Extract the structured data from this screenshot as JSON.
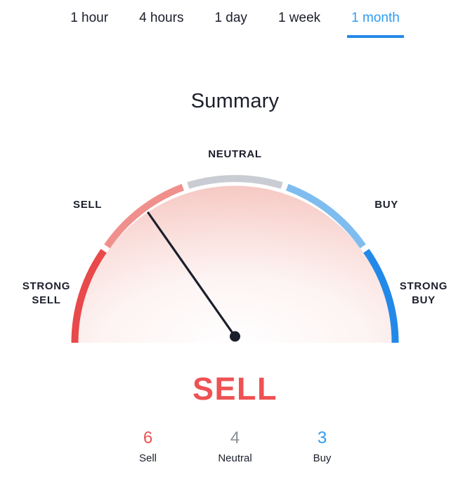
{
  "tabs": {
    "items": [
      {
        "label": "1 hour",
        "active": false
      },
      {
        "label": "4 hours",
        "active": false
      },
      {
        "label": "1 day",
        "active": false
      },
      {
        "label": "1 week",
        "active": false
      },
      {
        "label": "1 month",
        "active": true
      }
    ],
    "active_color": "#2f9cf4",
    "inactive_color": "#1b1f2b",
    "underline_color": "#2389e8"
  },
  "title": "Summary",
  "gauge": {
    "zone_labels": {
      "strong_sell_line1": "STRONG",
      "strong_sell_line2": "SELL",
      "sell": "SELL",
      "neutral": "NEUTRAL",
      "buy": "BUY",
      "strong_buy_line1": "STRONG",
      "strong_buy_line2": "BUY"
    },
    "verdict": "SELL",
    "verdict_color": "#ee5253",
    "needle_color": "#1b1f2b",
    "segment_colors": {
      "strong_sell": "#e8494a",
      "sell": "#f0908d",
      "neutral": "#c9ccd2",
      "buy": "#7fbdef",
      "strong_buy": "#2389e8"
    },
    "fill_color": "#f7cdc9"
  },
  "chart_data": {
    "type": "gauge",
    "title": "Summary",
    "verdict": "SELL",
    "needle_value": -1,
    "scale_min": -2,
    "scale_max": 2,
    "zones": [
      {
        "label": "STRONG SELL",
        "color": "#e8494a",
        "start_angle": 180,
        "end_angle": 144
      },
      {
        "label": "SELL",
        "color": "#f0908d",
        "start_angle": 144,
        "end_angle": 108
      },
      {
        "label": "NEUTRAL",
        "color": "#c9ccd2",
        "start_angle": 108,
        "end_angle": 72
      },
      {
        "label": "BUY",
        "color": "#7fbdef",
        "start_angle": 72,
        "end_angle": 36
      },
      {
        "label": "STRONG BUY",
        "color": "#2389e8",
        "start_angle": 36,
        "end_angle": 0
      }
    ],
    "categories": [
      "Sell",
      "Neutral",
      "Buy"
    ],
    "values": [
      6,
      4,
      3
    ],
    "legend_position": "bottom"
  },
  "counts": {
    "items": [
      {
        "value": "6",
        "label": "Sell",
        "color": "#ee5253"
      },
      {
        "value": "4",
        "label": "Neutral",
        "color": "#8b8f99"
      },
      {
        "value": "3",
        "label": "Buy",
        "color": "#2f9cf4"
      }
    ]
  }
}
